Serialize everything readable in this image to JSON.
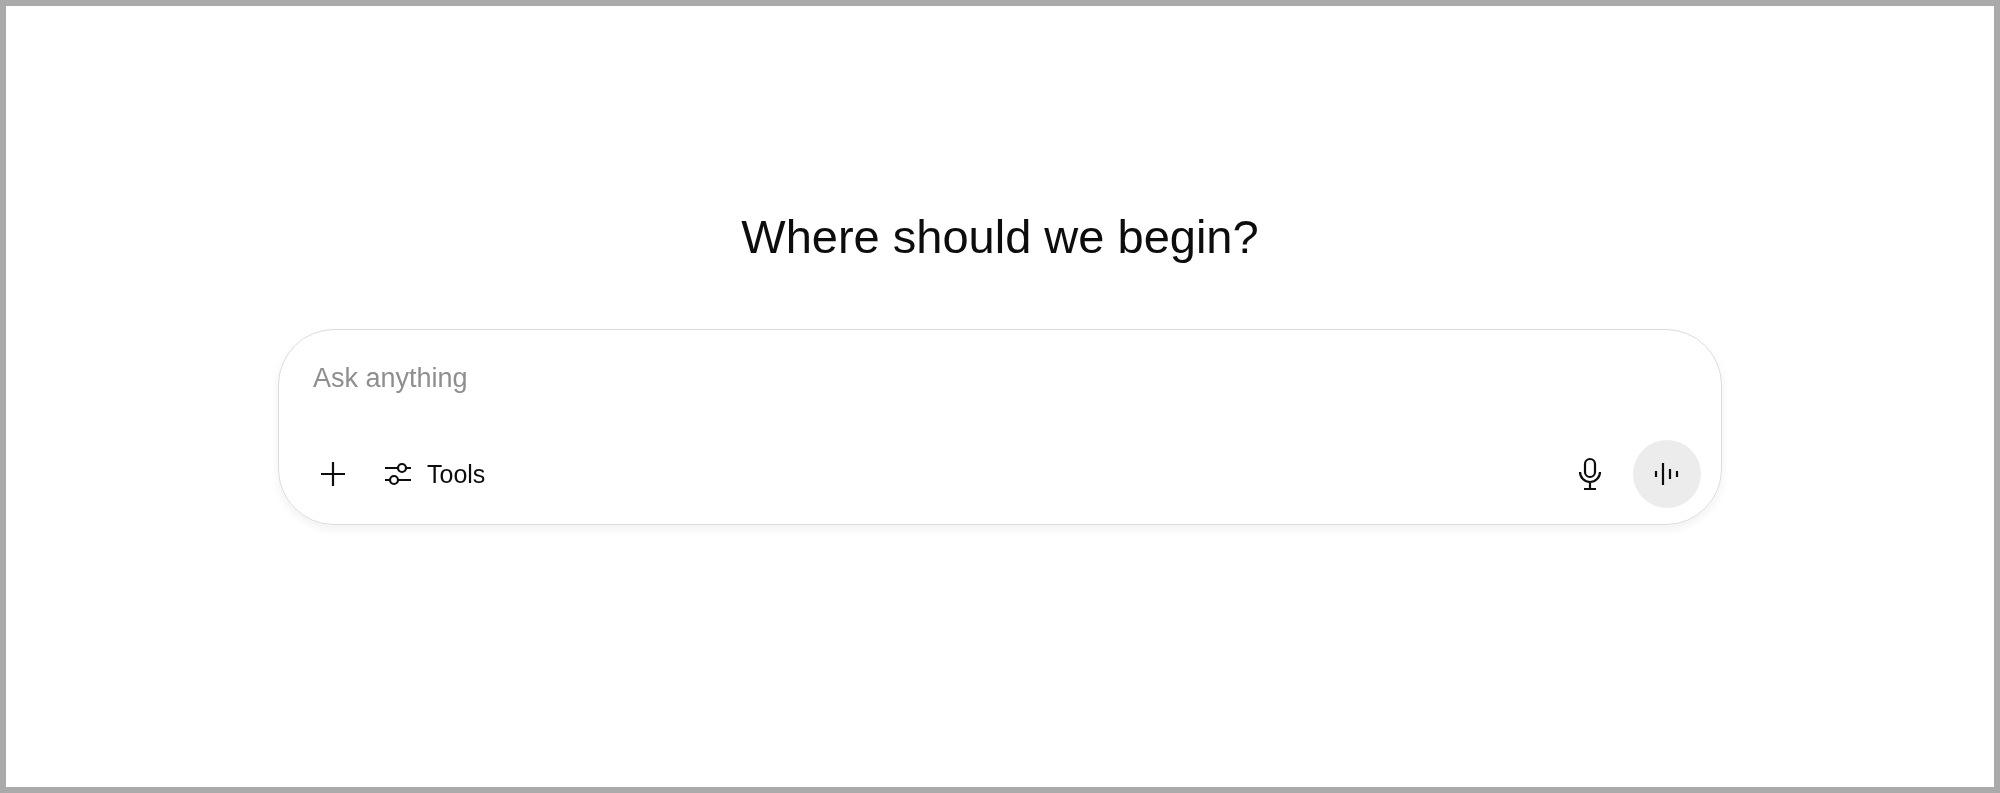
{
  "heading": "Where should we begin?",
  "composer": {
    "placeholder": "Ask anything",
    "buttons": [
      {
        "kind": "add"
      },
      {
        "kind": "tools",
        "label": "Tools"
      }
    ],
    "right_buttons": [
      {
        "kind": "mic"
      },
      {
        "kind": "voice"
      }
    ]
  }
}
